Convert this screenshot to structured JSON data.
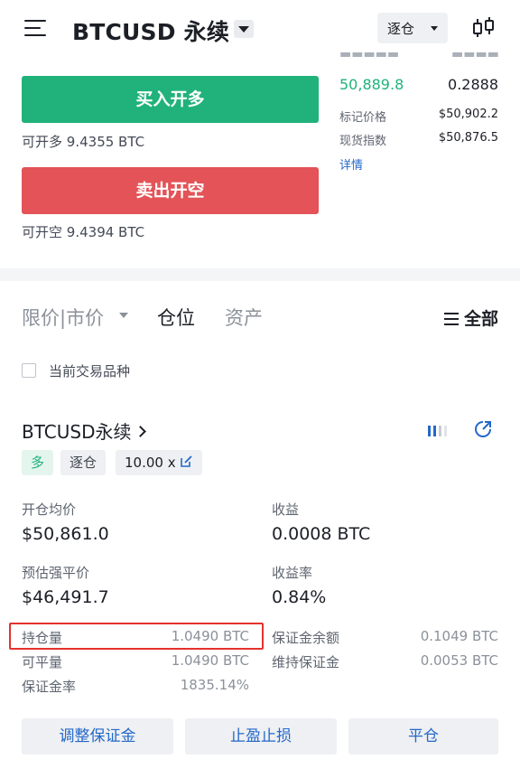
{
  "header": {
    "title": "BTCUSD 永续",
    "margin_mode": "逐仓",
    "menu_icon": "hamburger-icon",
    "chart_icon": "candlestick-icon"
  },
  "trade": {
    "buy_label": "买入开多",
    "buy_available_label": "可开多",
    "buy_available_value": "9.4355 BTC",
    "sell_label": "卖出开空",
    "sell_available_label": "可开空",
    "sell_available_value": "9.4394 BTC"
  },
  "orderbook": {
    "last_price": "50,889.8",
    "last_qty": "0.2888",
    "mark_price_label": "标记价格",
    "mark_price_value": "$50,902.2",
    "index_price_label": "现货指数",
    "index_price_value": "$50,876.5",
    "detail_link": "详情"
  },
  "tabs": {
    "order_type_limit": "限价",
    "order_type_market": "市价",
    "positions": "仓位",
    "assets": "资产",
    "filter_all": "全部"
  },
  "filter": {
    "current_symbol_label": "当前交易品种"
  },
  "position": {
    "symbol": "BTCUSD永续",
    "side_tag": "多",
    "mode_tag": "逐仓",
    "leverage_tag": "10.00 x",
    "entry_price_label": "开仓均价",
    "entry_price_value": "$50,861.0",
    "pnl_label": "收益",
    "pnl_value": "0.0008 BTC",
    "liq_price_label": "预估强平价",
    "liq_price_value": "$46,491.7",
    "roe_label": "收益率",
    "roe_value": "0.84%",
    "size_label": "持仓量",
    "size_value": "1.0490 BTC",
    "closable_label": "可平量",
    "closable_value": "1.0490 BTC",
    "margin_ratio_label": "保证金率",
    "margin_ratio_value": "1835.14%",
    "margin_balance_label": "保证金余额",
    "margin_balance_value": "0.1049 BTC",
    "maint_margin_label": "维持保证金",
    "maint_margin_value": "0.0053 BTC"
  },
  "actions": {
    "adjust_margin": "调整保证金",
    "tp_sl": "止盈止损",
    "close": "平仓"
  },
  "colors": {
    "buy": "#20b27a",
    "sell": "#e35357",
    "link": "#2468c9",
    "highlight": "#e5322d"
  }
}
